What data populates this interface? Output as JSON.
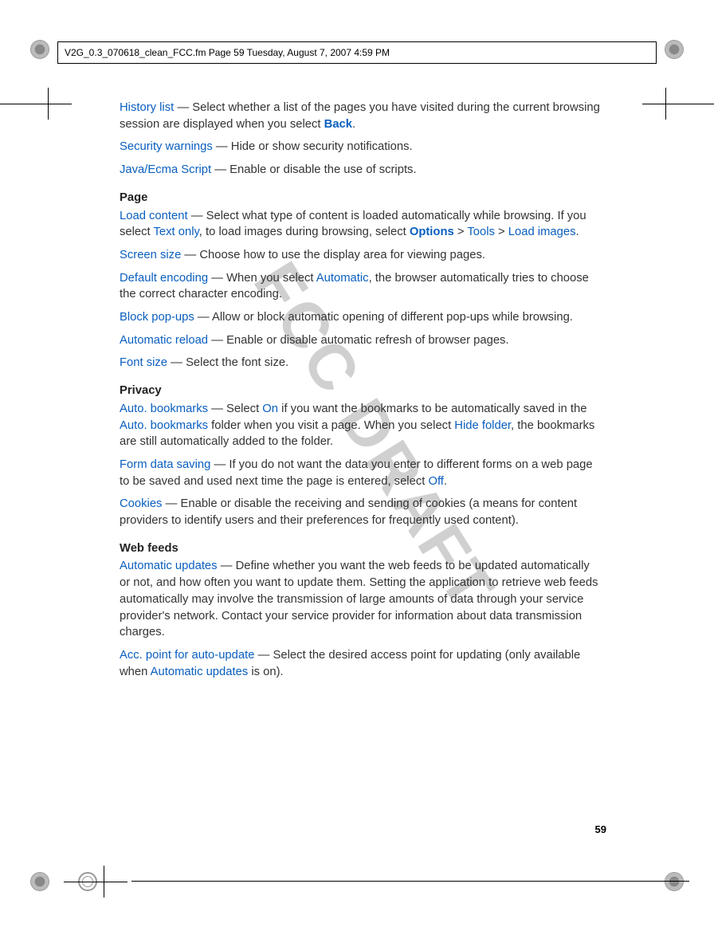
{
  "header": "V2G_0.3_070618_clean_FCC.fm  Page 59  Tuesday, August 7, 2007  4:59 PM",
  "watermark": "FCC DRAFT",
  "pageNumber": "59",
  "paragraphs": {
    "historyList": {
      "term": "History list",
      "body": " — Select whether a list of the pages you have visited during the current browsing session are displayed when you select ",
      "ref": "Back",
      "tail": "."
    },
    "securityWarnings": {
      "term": "Security warnings",
      "body": " — Hide or show security notifications."
    },
    "javaEcma": {
      "term": "Java/Ecma Script",
      "body": " — Enable or disable the use of scripts."
    },
    "pageHead": "Page",
    "loadContent": {
      "term": "Load content",
      "pre": " — Select what type of content is loaded automatically while browsing. If you select ",
      "ref1": "Text only",
      "mid": ", to load images during browsing, select ",
      "opt": "Options",
      "gt1": " > ",
      "ref2": "Tools",
      "gt2": " > ",
      "ref3": "Load images",
      "tail": "."
    },
    "screenSize": {
      "term": "Screen size",
      "body": " — Choose how to use the display area for viewing pages."
    },
    "defaultEncoding": {
      "term": "Default encoding",
      "pre": " — When you select ",
      "ref": "Automatic",
      "tail": ", the browser automatically tries to choose the correct character encoding."
    },
    "blockPopups": {
      "term": "Block pop-ups",
      "body": " — Allow or block automatic opening of different pop-ups while browsing."
    },
    "autoReload": {
      "term": "Automatic reload",
      "body": " — Enable or disable automatic refresh of browser pages."
    },
    "fontSize": {
      "term": "Font size",
      "body": " — Select the font size."
    },
    "privacyHead": "Privacy",
    "autoBookmarks": {
      "term": "Auto. bookmarks",
      "pre": " — Select ",
      "ref1": "On",
      "mid1": " if you want the bookmarks to be automatically saved in the ",
      "ref2": "Auto. bookmarks",
      "mid2": " folder when you visit a page. When you select ",
      "ref3": "Hide folder",
      "tail": ", the bookmarks are still automatically added to the folder."
    },
    "formData": {
      "term": "Form data saving",
      "pre": " — If you do not want the data you enter to different forms on a web page to be saved and used next time the page is entered, select ",
      "ref": "Off",
      "tail": "."
    },
    "cookies": {
      "term": "Cookies",
      "body": " — Enable or disable the receiving and sending of cookies (a means for content providers to identify users and their preferences for frequently used content)."
    },
    "webFeedsHead": "Web feeds",
    "autoUpdates": {
      "term": "Automatic updates",
      "body": " — Define whether you want the web feeds to be updated automatically or not, and how often you want to update them. Setting the application to retrieve web feeds automatically may involve the transmission of large amounts of data through your service provider's network. Contact your service provider for information about data transmission charges."
    },
    "accPoint": {
      "term": "Acc. point for auto-update",
      "pre": " — Select the desired access point for updating (only available when ",
      "ref": "Automatic updates",
      "tail": " is on)."
    }
  }
}
